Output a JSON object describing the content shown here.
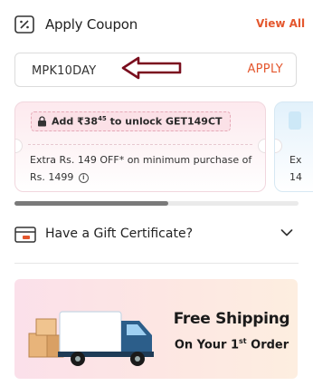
{
  "header": {
    "title": "Apply Coupon",
    "view_all_label": "View All",
    "accent_color": "#e4572e"
  },
  "coupon_input": {
    "value": "MPK10DAY",
    "apply_label": "APPLY"
  },
  "annotation": {
    "icon": "left-arrow-icon",
    "color": "#7a0e1e"
  },
  "offers": [
    {
      "unlock_prefix": "Add ₹38",
      "unlock_superscript": "45",
      "unlock_suffix": " to unlock GET149CT",
      "description": "Extra Rs. 149 OFF* on minimum purchase of Rs. 1499"
    },
    {
      "description_line1": "Ex",
      "description_line2": "14"
    }
  ],
  "gift": {
    "label": "Have a Gift Certificate?"
  },
  "banner": {
    "title": "Free Shipping",
    "subtitle_prefix": "On Your 1",
    "subtitle_superscript": "st",
    "subtitle_suffix": " Order"
  }
}
